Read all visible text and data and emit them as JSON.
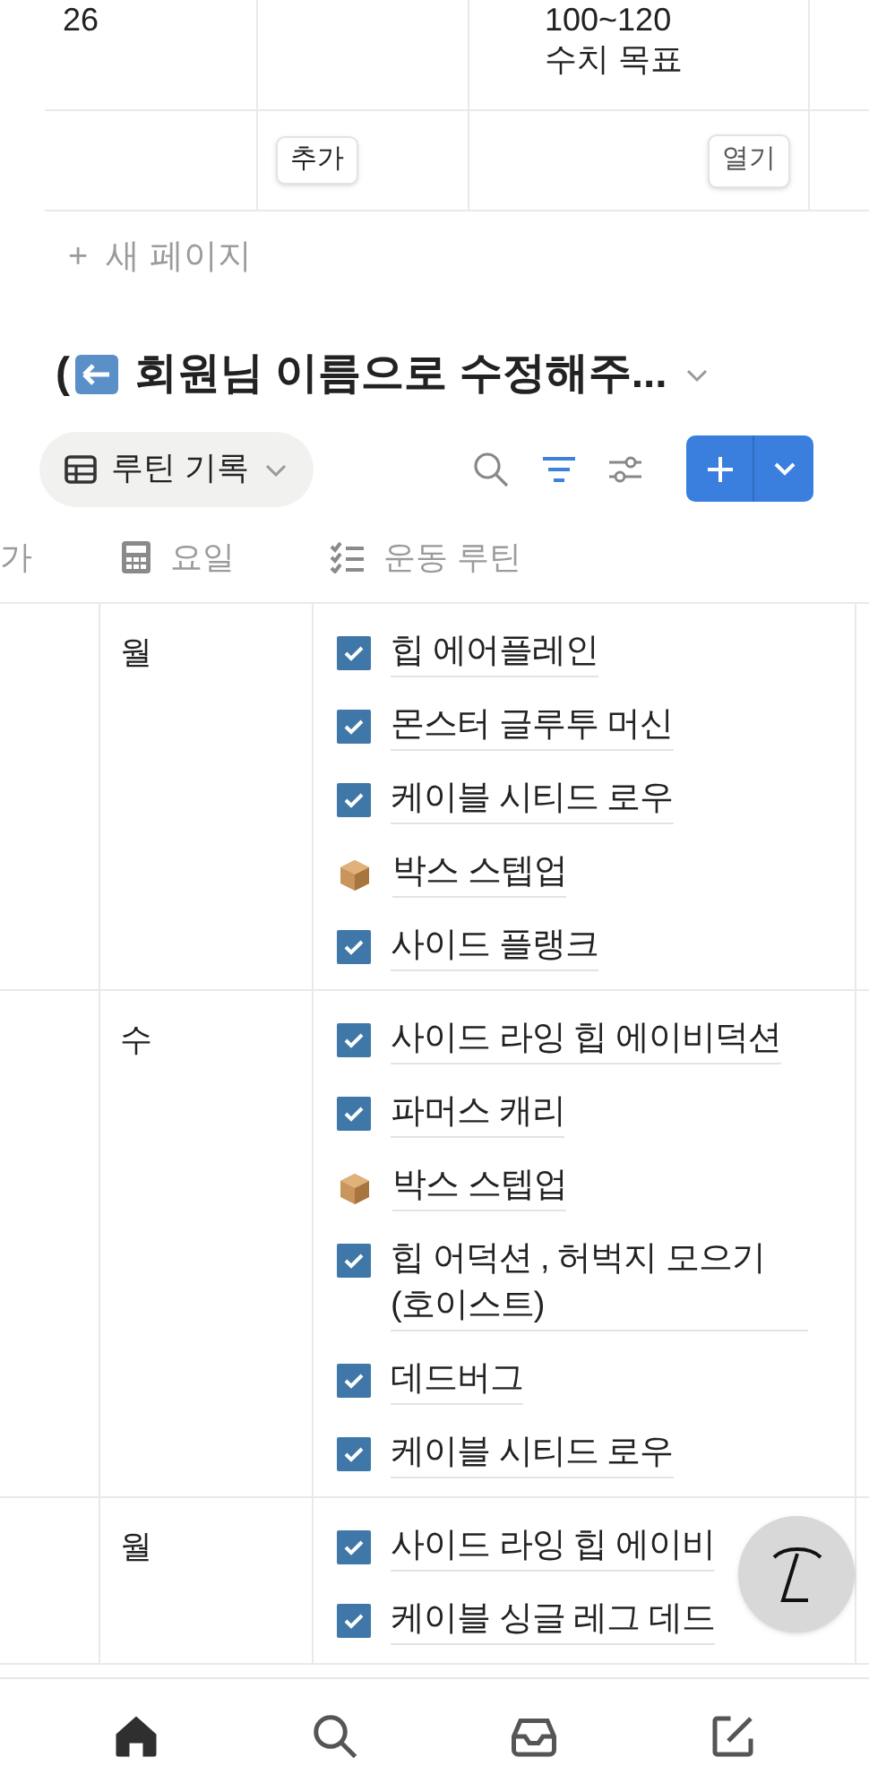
{
  "top_table": {
    "rows": [
      {
        "cells": [
          "26",
          "",
          "100~120\n수치 목표"
        ]
      }
    ],
    "buttons": [
      {
        "label": "추가"
      },
      {
        "label": "열기"
      }
    ]
  },
  "new_page": {
    "icon": "+",
    "label": "새 페이지"
  },
  "database": {
    "title": "(",
    "title_rest": "회원님 이름으로 수정해주...",
    "view": {
      "label": "루틴 기록"
    },
    "columns": [
      {
        "label": "가",
        "kind": "cut"
      },
      {
        "label": "요일",
        "kind": "formula"
      },
      {
        "label": "운동 루틴",
        "kind": "checklist"
      }
    ],
    "rows": [
      {
        "day": "월",
        "items": [
          {
            "kind": "check",
            "text": "힙 에어플레인"
          },
          {
            "kind": "check",
            "text": "몬스터 글루투 머신"
          },
          {
            "kind": "check",
            "text": "케이블 시티드 로우"
          },
          {
            "kind": "box",
            "text": "박스 스텝업"
          },
          {
            "kind": "check",
            "text": "사이드 플랭크"
          }
        ]
      },
      {
        "day": "수",
        "items": [
          {
            "kind": "check",
            "text": "사이드 라잉 힙 에이비덕션"
          },
          {
            "kind": "check",
            "text": "파머스 캐리"
          },
          {
            "kind": "box",
            "text": "박스 스텝업"
          },
          {
            "kind": "check",
            "text": "힙 어덕션 , 허벅지 모으기 (호이스트)"
          },
          {
            "kind": "check",
            "text": "데드버그"
          },
          {
            "kind": "check",
            "text": "케이블 시티드 로우"
          }
        ]
      },
      {
        "day": "월",
        "items": [
          {
            "kind": "check",
            "text": "사이드 라잉 힙 에이비"
          },
          {
            "kind": "check",
            "text": "케이블 싱글 레그 데드"
          }
        ]
      }
    ]
  },
  "bottom_nav": [
    {
      "kind": "home",
      "selected": true
    },
    {
      "kind": "search",
      "selected": false
    },
    {
      "kind": "inbox",
      "selected": false
    },
    {
      "kind": "compose",
      "selected": false
    }
  ]
}
